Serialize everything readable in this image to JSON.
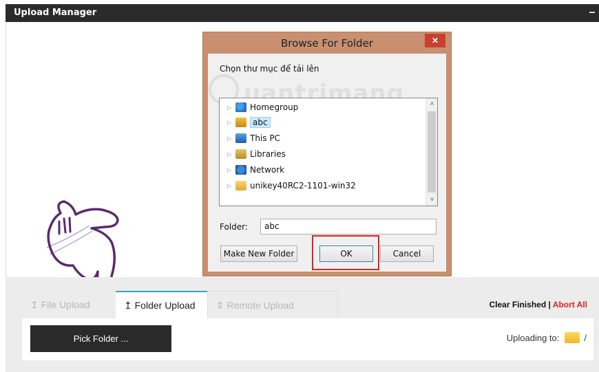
{
  "window": {
    "title": "Upload Manager"
  },
  "dialog": {
    "title": "Browse For Folder",
    "close_label": "✕",
    "prompt": "Chọn thư mục để tải lên",
    "watermark": "uantrimang",
    "tree_items": [
      {
        "label": "Homegroup",
        "icon": "homegroup-icon",
        "selected": false
      },
      {
        "label": "abc",
        "icon": "user-folder-icon",
        "selected": true
      },
      {
        "label": "This PC",
        "icon": "this-pc-icon",
        "selected": false
      },
      {
        "label": "Libraries",
        "icon": "libraries-icon",
        "selected": false
      },
      {
        "label": "Network",
        "icon": "network-icon",
        "selected": false
      },
      {
        "label": "unikey40RC2-1101-win32",
        "icon": "folder-icon",
        "selected": false
      }
    ],
    "folder_label": "Folder:",
    "folder_value": "abc",
    "make_new_folder_label": "Make New Folder",
    "ok_label": "OK",
    "cancel_label": "Cancel"
  },
  "tabs": {
    "file_upload": "↥ File Upload",
    "folder_upload": "↥ Folder Upload",
    "remote_upload": "⇕ Remote Upload"
  },
  "actions": {
    "clear_finished": "Clear Finished",
    "separator": " | ",
    "abort_all": "Abort All"
  },
  "panel": {
    "pick_folder_label": "Pick Folder ...",
    "uploading_to_label": "Uploading to:",
    "uploading_path": "/"
  },
  "colors": {
    "highlight": "#e21f1f",
    "active_tab_accent": "#2aa7c5",
    "abort": "#e02020",
    "dialog_frame": "#c88f70"
  }
}
